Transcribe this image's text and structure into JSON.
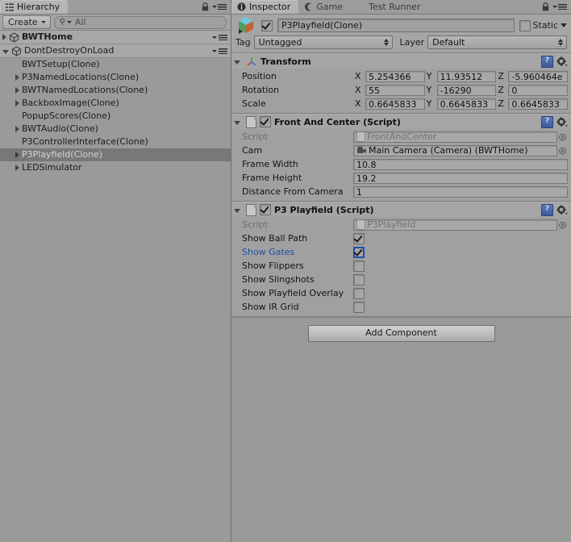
{
  "hierarchy": {
    "tab_label": "Hierarchy",
    "tab_icon": "hierarchy-icon",
    "create_label": "Create",
    "search_value": "All",
    "search_icon": "search-icon",
    "lock_icon": "lock-icon",
    "menu_icon": "panel-menu-icon",
    "items": [
      {
        "label": "BWTHome",
        "indent": 0,
        "type": "scene",
        "expanded": false,
        "arrow": "right",
        "bold": true,
        "selected": false,
        "icon": "unity-scene-icon",
        "menu": true
      },
      {
        "label": "DontDestroyOnLoad",
        "indent": 0,
        "type": "scene",
        "expanded": true,
        "arrow": "down",
        "bold": false,
        "selected": false,
        "icon": "unity-scene-icon",
        "menu": true
      },
      {
        "label": "BWTSetup(Clone)",
        "indent": 1,
        "type": "object",
        "arrow": "none",
        "bold": false,
        "selected": false,
        "menu": false
      },
      {
        "label": "P3NamedLocations(Clone)",
        "indent": 1,
        "type": "object",
        "arrow": "right",
        "bold": false,
        "selected": false,
        "menu": false
      },
      {
        "label": "BWTNamedLocations(Clone)",
        "indent": 1,
        "type": "object",
        "arrow": "right",
        "bold": false,
        "selected": false,
        "menu": false
      },
      {
        "label": "BackboxImage(Clone)",
        "indent": 1,
        "type": "object",
        "arrow": "right",
        "bold": false,
        "selected": false,
        "menu": false
      },
      {
        "label": "PopupScores(Clone)",
        "indent": 1,
        "type": "object",
        "arrow": "none",
        "bold": false,
        "selected": false,
        "menu": false
      },
      {
        "label": "BWTAudio(Clone)",
        "indent": 1,
        "type": "object",
        "arrow": "right",
        "bold": false,
        "selected": false,
        "menu": false
      },
      {
        "label": "P3ControllerInterface(Clone)",
        "indent": 1,
        "type": "object",
        "arrow": "none",
        "bold": false,
        "selected": false,
        "menu": false
      },
      {
        "label": "P3Playfield(Clone)",
        "indent": 1,
        "type": "object",
        "arrow": "right",
        "bold": false,
        "selected": true,
        "menu": false
      },
      {
        "label": "LEDSimulator",
        "indent": 1,
        "type": "object",
        "arrow": "right",
        "bold": false,
        "selected": false,
        "menu": false
      }
    ]
  },
  "inspector": {
    "tabs": [
      {
        "label": "Inspector",
        "icon": "info-icon",
        "active": true
      },
      {
        "label": "Game",
        "icon": "game-icon",
        "active": false
      },
      {
        "label": "Test Runner",
        "icon": "",
        "active": false
      }
    ],
    "lock_icon": "lock-icon",
    "menu_icon": "panel-menu-icon",
    "object_header": {
      "icon": "gameobject-prefab-icon",
      "enabled": true,
      "name": "P3Playfield(Clone)",
      "static_label": "Static",
      "static_checked": false,
      "tag_label": "Tag",
      "tag_value": "Untagged",
      "layer_label": "Layer",
      "layer_value": "Default"
    },
    "components": [
      {
        "name": "transform",
        "title": "Transform",
        "icon": "transform-axis-icon",
        "has_toggle": false,
        "expanded": true,
        "help_icon": "help-book-icon",
        "gear_icon": "gear-icon",
        "vectors": [
          {
            "label": "Position",
            "x": "5.254366",
            "y": "11.93512",
            "z": "-5.960464e"
          },
          {
            "label": "Rotation",
            "x": "55",
            "y": "-16290",
            "z": "0"
          },
          {
            "label": "Scale",
            "x": "0.6645833",
            "y": "0.6645833",
            "z": "0.6645833"
          }
        ]
      },
      {
        "name": "front-and-center",
        "title": "Front And Center (Script)",
        "icon": "script-icon",
        "has_toggle": true,
        "enabled": true,
        "expanded": true,
        "help_icon": "help-book-icon",
        "gear_icon": "gear-icon",
        "fields": [
          {
            "label": "Script",
            "kind": "object",
            "value": "FrontAndCenter",
            "disabled": true,
            "icon": "script-asset-icon",
            "picker": "◎"
          },
          {
            "label": "Cam",
            "kind": "object",
            "value": "Main Camera (Camera) (BWTHome)",
            "disabled": false,
            "icon": "camera-icon",
            "picker": "◎"
          },
          {
            "label": "Frame Width",
            "kind": "text",
            "value": "10.8"
          },
          {
            "label": "Frame Height",
            "kind": "text",
            "value": "19.2"
          },
          {
            "label": "Distance From Camera",
            "kind": "text",
            "value": "1"
          }
        ]
      },
      {
        "name": "p3-playfield",
        "title": "P3 Playfield (Script)",
        "icon": "script-icon",
        "has_toggle": true,
        "enabled": true,
        "expanded": true,
        "help_icon": "help-book-icon",
        "gear_icon": "gear-icon",
        "fields": [
          {
            "label": "Script",
            "kind": "object",
            "value": "P3Playfield",
            "disabled": true,
            "icon": "script-asset-icon",
            "picker": "◎"
          },
          {
            "label": "Show Ball Path",
            "kind": "checkbox",
            "checked": true,
            "override": false
          },
          {
            "label": "Show Gates",
            "kind": "checkbox",
            "checked": true,
            "override": true
          },
          {
            "label": "Show Flippers",
            "kind": "checkbox",
            "checked": false,
            "override": false
          },
          {
            "label": "Show Slingshots",
            "kind": "checkbox",
            "checked": false,
            "override": false
          },
          {
            "label": "Show Playfield Overlay",
            "kind": "checkbox",
            "checked": false,
            "override": false
          },
          {
            "label": "Show IR Grid",
            "kind": "checkbox",
            "checked": false,
            "override": false
          }
        ]
      }
    ],
    "add_component_label": "Add Component"
  },
  "colors": {
    "panel_bg": "#9a9a9a",
    "header_bg": "#a5a5a5",
    "selection": "#787878",
    "override_blue": "#1b4fa8",
    "field_bg": "#a8a8a8"
  }
}
